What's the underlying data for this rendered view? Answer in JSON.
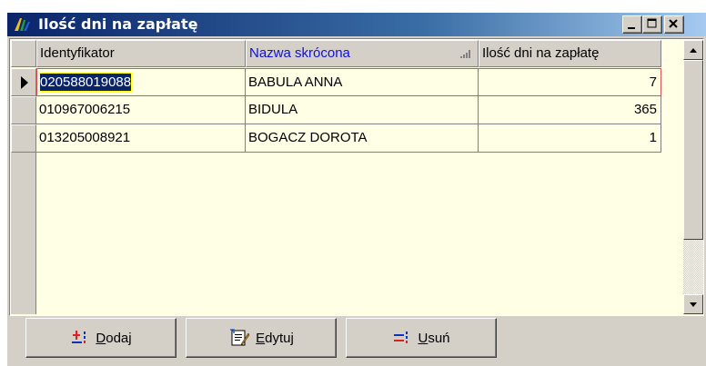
{
  "window": {
    "title": "Ilość dni na zapłatę",
    "app_icon": "app-icon",
    "controls": [
      "minimize-icon",
      "maximize-icon",
      "close-icon"
    ]
  },
  "grid": {
    "columns": [
      {
        "label": "Identyfikator"
      },
      {
        "label": "Nazwa skrócona",
        "sorted": true,
        "sort_icon": "sort-icon"
      },
      {
        "label": "Ilość dni na zapłatę"
      }
    ],
    "rows": [
      {
        "id": "020588019088",
        "name": "BABULA ANNA",
        "days": "7",
        "selected": true
      },
      {
        "id": "010967006215",
        "name": "BIDULA",
        "days": "365",
        "selected": false
      },
      {
        "id": "013205008921",
        "name": "BOGACZ DOROTA",
        "days": "1",
        "selected": false
      }
    ],
    "colors": {
      "background": "#ffffe6",
      "selected": "#0a246a",
      "sorted_header": "#1010d8",
      "current_row_border": "#e05050"
    }
  },
  "buttons": {
    "add": {
      "accel": "D",
      "rest": "odaj",
      "icon": "add-record-icon"
    },
    "edit": {
      "accel": "E",
      "rest": "dytuj",
      "icon": "edit-record-icon"
    },
    "delete": {
      "accel": "U",
      "rest": "suń",
      "icon": "delete-record-icon"
    }
  }
}
